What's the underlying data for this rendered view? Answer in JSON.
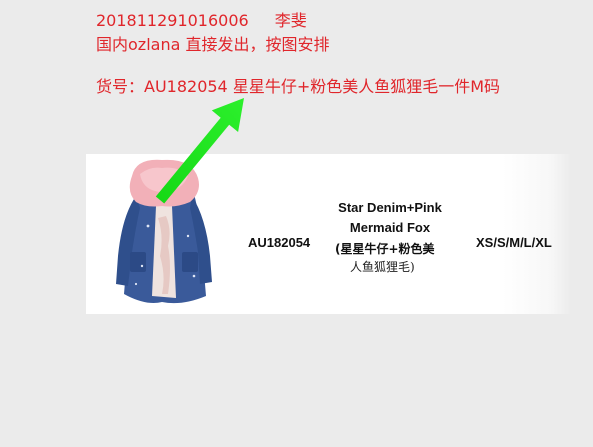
{
  "note": {
    "order_id": "201811291016006",
    "customer": "李斐",
    "shipping": "国内ozlana 直接发出，按图安排",
    "item_line": "货号：AU182054 星星牛仔+粉色美人鱼狐狸毛一件M码"
  },
  "product": {
    "sku": "AU182054",
    "name_en_1": "Star Denim+Pink",
    "name_en_2": "Mermaid Fox",
    "name_cn_1": "(星星牛仔+粉色美",
    "name_cn_2": "人鱼狐狸毛)",
    "sizes": "XS/S/M/L/XL",
    "image_icon": "parka-with-pink-fur-hood-photo"
  },
  "annotation": {
    "arrow_icon": "green-pointer-arrow",
    "arrow_color": "#1ee81e"
  },
  "colors": {
    "note_text": "#e0262b",
    "background": "#ebebeb"
  }
}
